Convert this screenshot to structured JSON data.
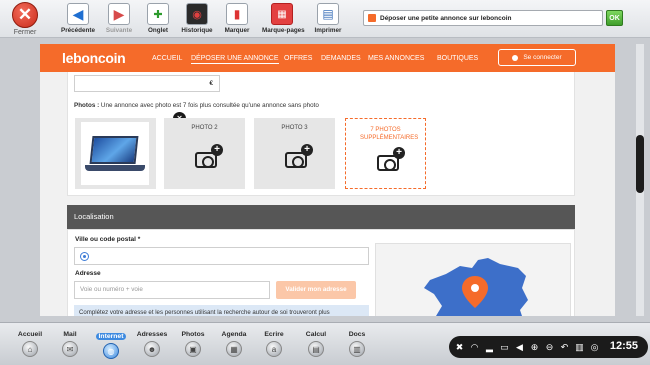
{
  "toolbar": {
    "close_label": "Fermer",
    "buttons": [
      {
        "label": "Précédente",
        "icon": "back-arrow-icon"
      },
      {
        "label": "Suivante",
        "icon": "forward-arrow-icon"
      },
      {
        "label": "Onglet",
        "icon": "new-tab-icon"
      },
      {
        "label": "Historique",
        "icon": "history-icon"
      },
      {
        "label": "Marquer",
        "icon": "bookmark-icon"
      },
      {
        "label": "Marque-pages",
        "icon": "bookmarks-icon"
      },
      {
        "label": "Imprimer",
        "icon": "printer-icon"
      }
    ],
    "url": "Déposer une petite annonce sur leboncoin",
    "ok_label": "OK"
  },
  "site": {
    "logo": "leboncoin",
    "nav": [
      "ACCUEIL",
      "DÉPOSER UNE ANNONCE",
      "OFFRES",
      "DEMANDES",
      "MES ANNONCES",
      "BOUTIQUES"
    ],
    "connect_label": "Se connecter"
  },
  "form": {
    "price_suffix": "€",
    "photo_hint_bold": "Photos :",
    "photo_hint_text": " Une annonce avec photo est 7 fois plus consultée qu'une annonce sans photo",
    "photo_slots": [
      "PHOTO 2",
      "PHOTO 3"
    ],
    "extra_photos_label": "7 PHOTOS SUPPLÉMENTAIRES",
    "remove_symbol": "×",
    "localisation_title": "Localisation",
    "city_label": "Ville ou code postal *",
    "address_label": "Adresse",
    "address_placeholder": "Voie ou numéro + voie",
    "validate_label": "Valider mon adresse",
    "info_text": "Complétez votre adresse et les personnes utilisant la recherche autour de soi trouveront plus"
  },
  "dock": {
    "items": [
      "Accueil",
      "Mail",
      "Internet",
      "Adresses",
      "Photos",
      "Agenda",
      "Ecrire",
      "Calcul",
      "Docs"
    ],
    "active": "Internet"
  },
  "system": {
    "clock": "12:55"
  },
  "colors": {
    "brand": "#f56b2a",
    "section_header": "#565656",
    "map_blue": "#3d6fc9"
  }
}
